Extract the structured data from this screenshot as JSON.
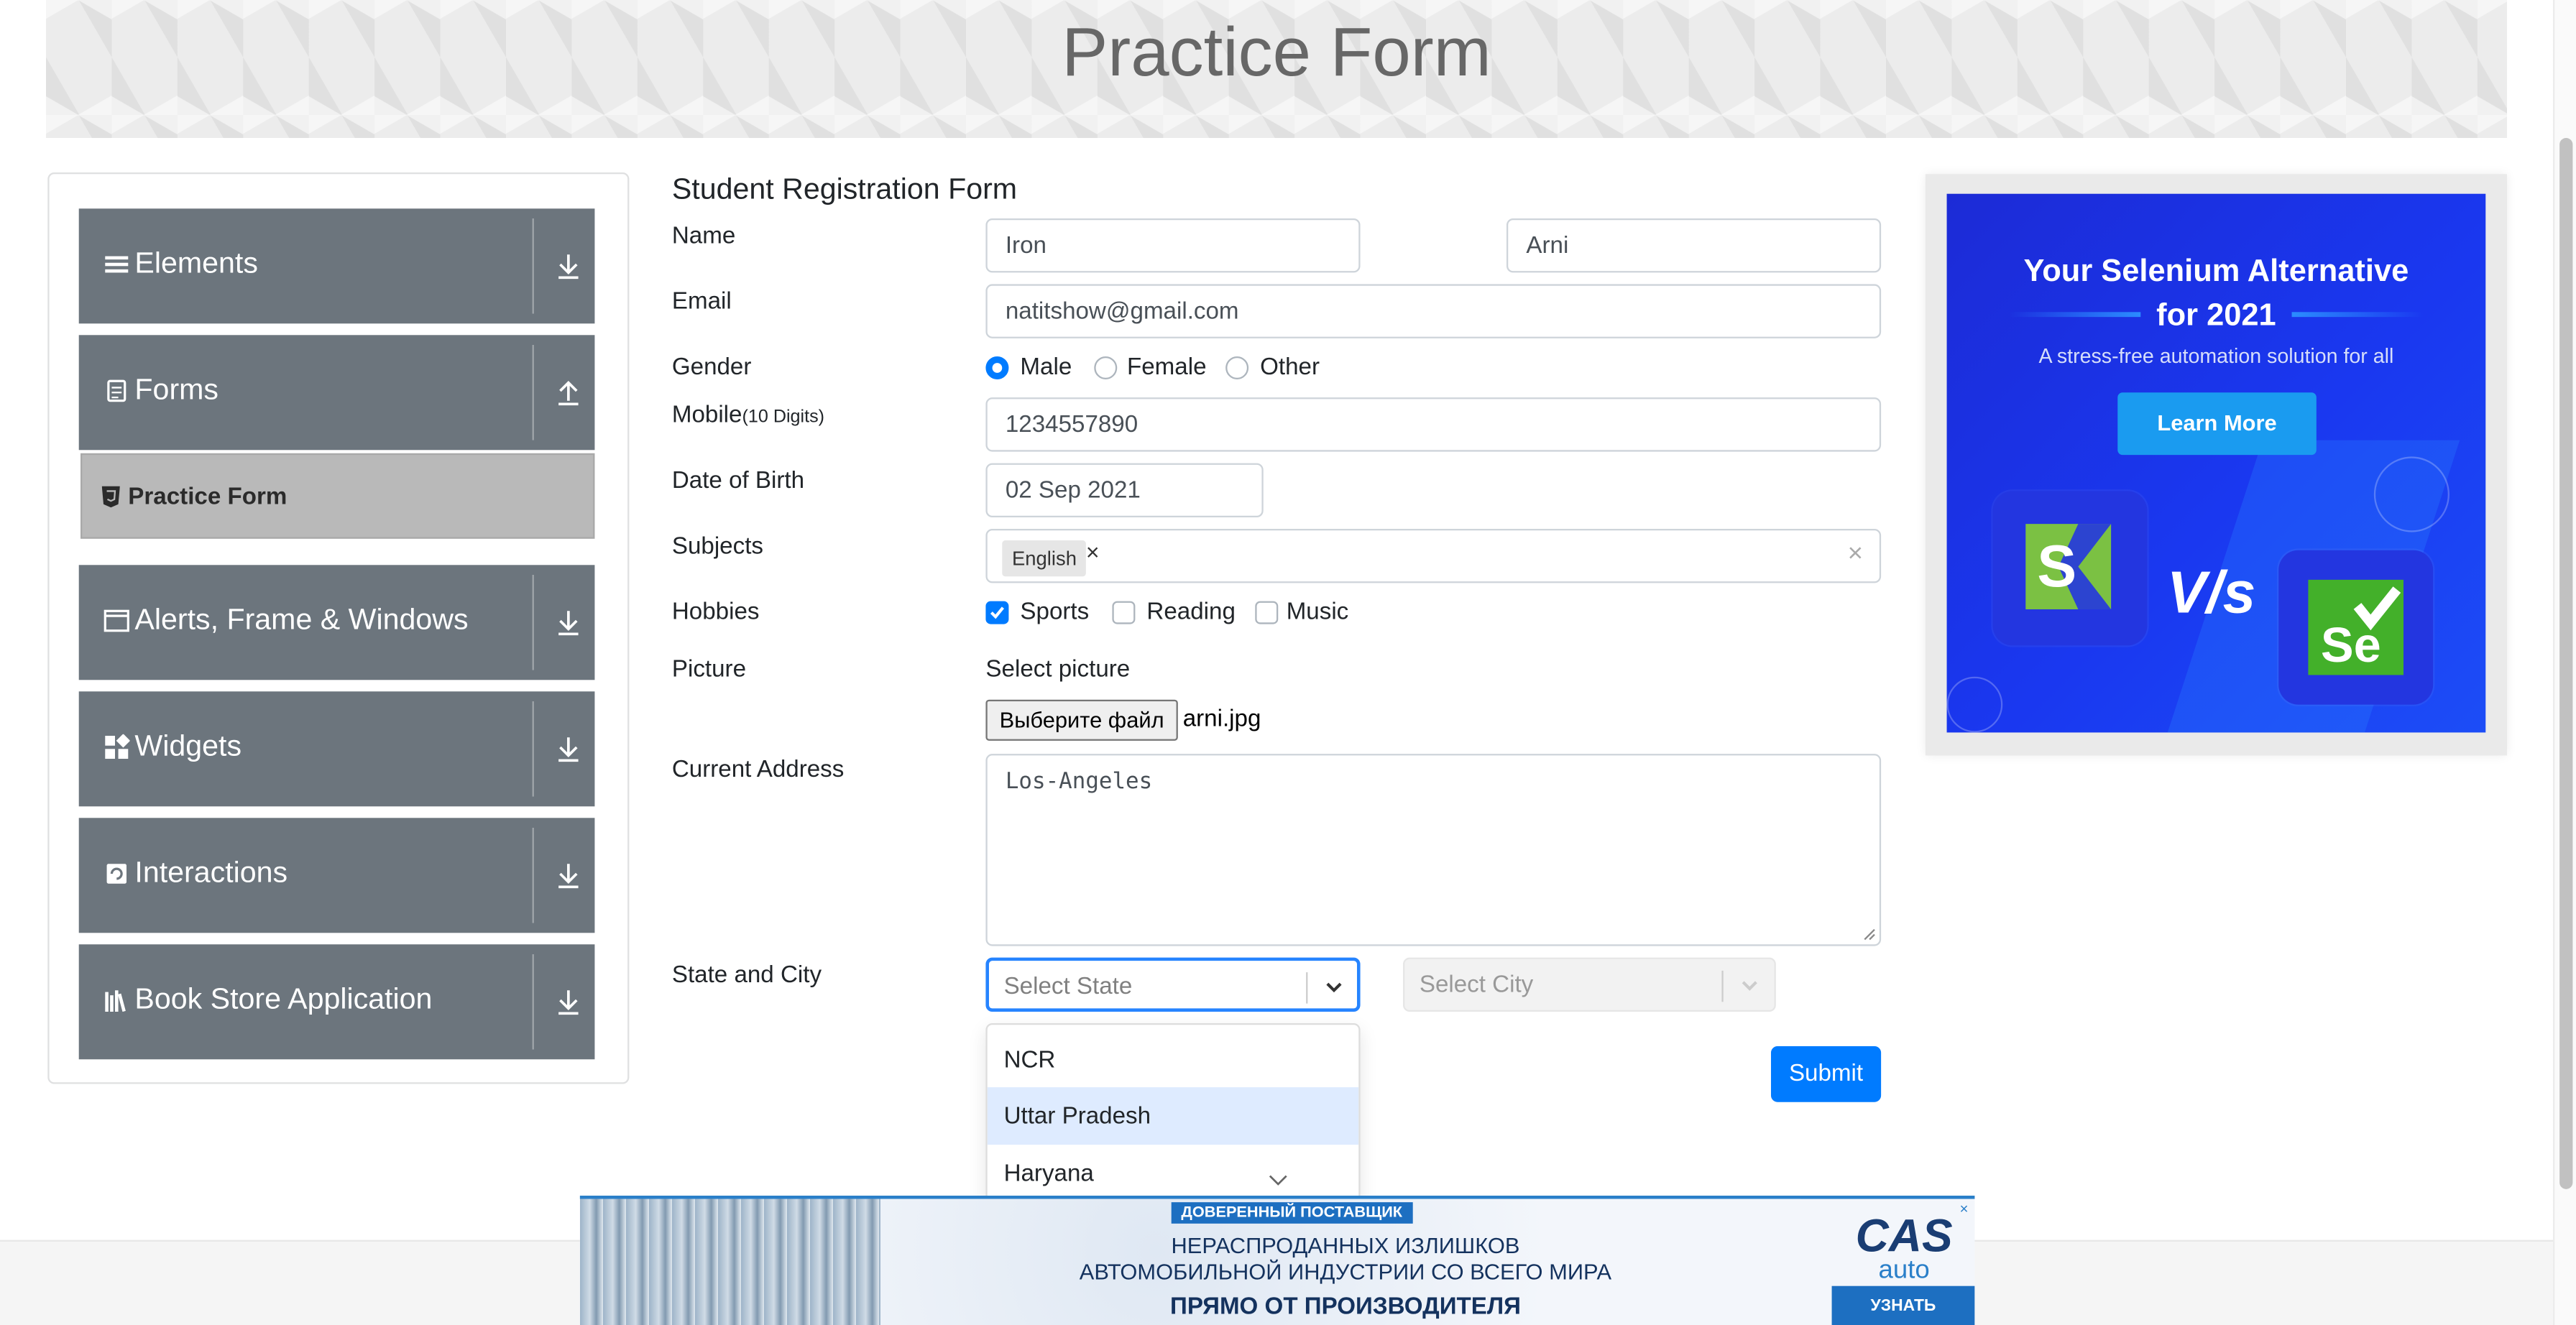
{
  "header": {
    "title": "Practice Form"
  },
  "sidebar": {
    "groups": [
      {
        "label": "Elements",
        "icon": "list-icon",
        "arrow": "download-arrow-icon"
      },
      {
        "label": "Forms",
        "icon": "document-icon",
        "arrow": "upload-arrow-icon"
      },
      {
        "label": "Alerts, Frame & Windows",
        "icon": "window-icon",
        "arrow": "download-arrow-icon"
      },
      {
        "label": "Widgets",
        "icon": "widgets-icon",
        "arrow": "download-arrow-icon"
      },
      {
        "label": "Interactions",
        "icon": "interactions-icon",
        "arrow": "download-arrow-icon"
      },
      {
        "label": "Book Store Application",
        "icon": "books-icon",
        "arrow": "download-arrow-icon"
      }
    ],
    "active_item": {
      "label": "Practice Form",
      "icon": "html5-icon"
    }
  },
  "form": {
    "title": "Student Registration Form",
    "name_label": "Name",
    "first_name": "Iron",
    "last_name": "Arni",
    "email_label": "Email",
    "email": "natitshow@gmail.com",
    "gender_label": "Gender",
    "genders": [
      "Male",
      "Female",
      "Other"
    ],
    "gender_selected": "Male",
    "mobile_label": "Mobile",
    "mobile_hint": "(10 Digits)",
    "mobile": "1234557890",
    "dob_label": "Date of Birth",
    "dob": "02 Sep 2021",
    "subjects_label": "Subjects",
    "subjects": [
      "English"
    ],
    "subject_remove": "×",
    "subjects_clear": "×",
    "hobbies_label": "Hobbies",
    "hobbies": [
      {
        "label": "Sports",
        "checked": true
      },
      {
        "label": "Reading",
        "checked": false
      },
      {
        "label": "Music",
        "checked": false
      }
    ],
    "picture_label": "Picture",
    "picture_caption": "Select picture",
    "file_button": "Выберите файл",
    "file_name": "arni.jpg",
    "address_label": "Current Address",
    "address": "Los-Angeles",
    "state_city_label": "State and City",
    "state_placeholder": "Select State",
    "city_placeholder": "Select City",
    "state_options": [
      "NCR",
      "Uttar Pradesh",
      "Haryana"
    ],
    "state_option_focused": "Uttar Pradesh",
    "submit": "Submit"
  },
  "ad_right": {
    "headline_1": "Your Selenium Alternative",
    "headline_2": "for 2021",
    "subtitle": "A stress-free automation solution for all",
    "button": "Learn More",
    "vs": "V/s",
    "logo_left_letter": "S",
    "logo_right_text": "Se"
  },
  "ad_bottom": {
    "tag": "ДОВЕРЕННЫЙ ПОСТАВЩИК",
    "line_1": "НЕРАСПРОДАННЫХ ИЗЛИШКОВ",
    "line_2": "АВТОМОБИЛЬНОЙ ИНДУСТРИИ СО ВСЕГО МИРА",
    "line_3": "ПРЯМО ОТ ПРОИЗВОДИТЕЛЯ",
    "logo_top": "CAS",
    "logo_bottom": "auto",
    "cta": "УЗНАТЬ БОЛЬШЕ",
    "close": "×"
  },
  "colors": {
    "primary": "#007bff",
    "sidebar_group": "#6c757d",
    "sidebar_active": "#b9b9b9",
    "select_focus": "#2684ff",
    "option_focus": "#deebff",
    "ad_blue": "#1c2bd6"
  }
}
